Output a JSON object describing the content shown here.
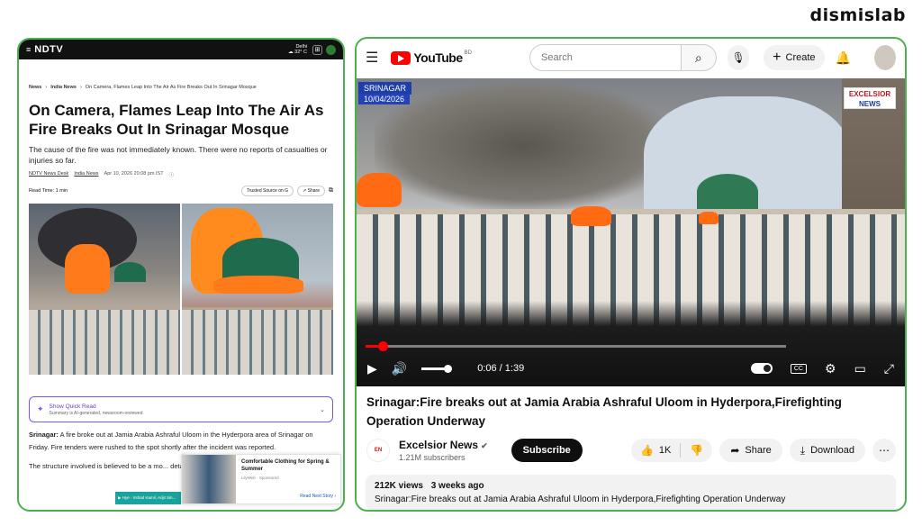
{
  "brand": "dismislab",
  "ndtv": {
    "logo": "NDTV",
    "menu_icon": "≡",
    "weather_city": "Delhi",
    "weather_temp": "☁ 32° C",
    "breadcrumb": [
      "News",
      "India News",
      "On Camera, Flames Leap Into The Air As Fire Breaks Out In Srinagar Mosque"
    ],
    "headline": "On Camera, Flames Leap Into The Air As Fire Breaks Out In Srinagar Mosque",
    "subhead": "The cause of the fire was not immediately known. There were no reports of casualties or injuries so far.",
    "byline_author": "NDTV News Desk",
    "byline_section": "India News",
    "byline_date": "Apr 10, 2026 20:08 pm IST",
    "read_time": "Read Time: 1 min",
    "trusted_label": "Trusted Source on G",
    "share_label": "Share",
    "quick_read_title": "Show Quick Read",
    "quick_read_sub": "Summary is AI-generated, newsroom-reviewed",
    "para1_lead": "Srinagar:",
    "para1_text": " A fire broke out at Jamia Arabia Ashraful Uloom in the Hyderpora area of Srinagar on Friday. Fire tenders were rushed to the spot shortly after the incident was reported.",
    "para2_text": "The structure involved is believed to be a mo... details were not immediately clear",
    "ad_title": "Comfortable Clothing for Spring & Summer",
    "ad_sponsor": "LilyWeb · Sponsored",
    "ad_next": "Read Next Story ›",
    "ticker_text": "▶ Hye · Irshad Kamil, Arijit Sin..."
  },
  "youtube": {
    "logo_text": "YouTube",
    "country_code": "BD",
    "search_placeholder": "Search",
    "create_label": "Create",
    "overlay_place": "SRINAGAR",
    "overlay_date": "10/04/2026",
    "channel_logo_line1": "EXCELSIOR",
    "channel_logo_line2": "NEWS",
    "time_display": "0:06 / 1:39",
    "progress_fraction": 0.04,
    "title": "Srinagar:Fire breaks out at Jamia Arabia Ashraful Uloom in Hyderpora,Firefighting Operation Underway",
    "channel_name": "Excelsior News",
    "verified_mark": "✔",
    "subscribers": "1.21M subscribers",
    "subscribe_label": "Subscribe",
    "likes": "1K",
    "share_label": "Share",
    "download_label": "Download",
    "views": "212K views",
    "age": "3 weeks ago",
    "description": "Srinagar:Fire breaks out at Jamia Arabia Ashraful Uloom in Hyderpora,Firefighting Operation Underway"
  },
  "colors": {
    "border_green": "#4caf50",
    "youtube_red": "#ff0000",
    "quick_read_purple": "#7b5bd6",
    "overlay_blue": "#1f3fa8"
  }
}
